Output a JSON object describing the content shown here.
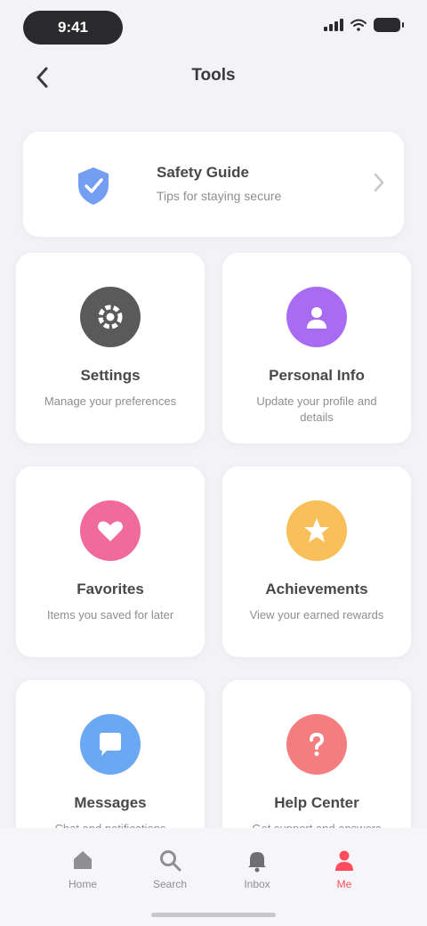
{
  "status_bar": {
    "time": "9:41"
  },
  "nav": {
    "title": "Tools"
  },
  "banner": {
    "title": "Safety Guide",
    "subtitle": "Tips for staying secure",
    "icon": "shield-icon",
    "accent": "#5b8def"
  },
  "cards": [
    {
      "title": "Settings",
      "desc": "Manage your preferences",
      "icon": "gear-icon",
      "color": "#5a5a5a"
    },
    {
      "title": "Personal Info",
      "desc": "Update your profile and details",
      "icon": "user-icon",
      "color": "#a86cf2"
    },
    {
      "title": "Favorites",
      "desc": "Items you saved for later",
      "icon": "heart-icon",
      "color": "#f06a9b"
    },
    {
      "title": "Achievements",
      "desc": "View your earned rewards",
      "icon": "star-icon",
      "color": "#f9bf5a"
    },
    {
      "title": "Messages",
      "desc": "Chat and notifications",
      "icon": "chat-icon",
      "color": "#6aa8f3"
    },
    {
      "title": "Help Center",
      "desc": "Get support and answers",
      "icon": "help-icon",
      "color": "#f47d7f"
    }
  ],
  "tabs": [
    {
      "label": "Home",
      "icon": "home-icon",
      "active": false
    },
    {
      "label": "Search",
      "icon": "search-icon",
      "active": false
    },
    {
      "label": "Inbox",
      "icon": "bell-icon",
      "active": false
    },
    {
      "label": "Me",
      "icon": "profile-icon",
      "active": true
    }
  ],
  "colors": {
    "active_tab": "#ff4d5e",
    "background": "#f2f2f7"
  }
}
